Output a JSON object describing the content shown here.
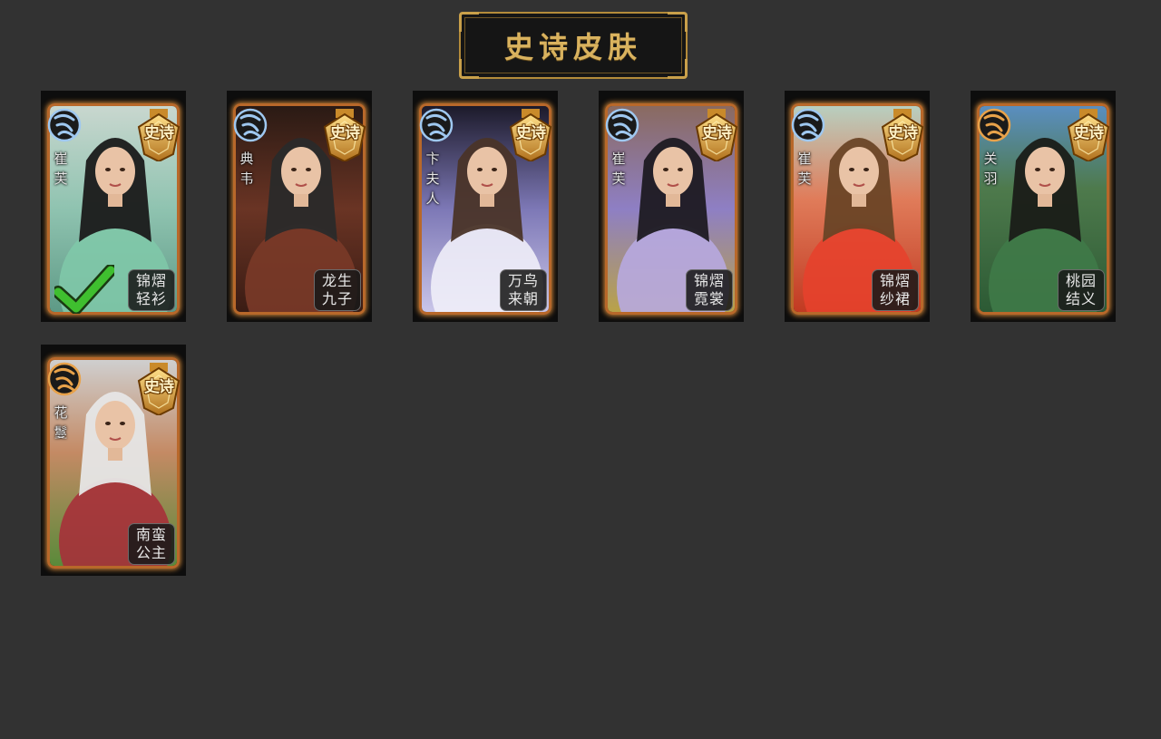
{
  "header": {
    "title": "史诗皮肤"
  },
  "badge_label": "史诗",
  "colors": {
    "background": "#323232",
    "gold": "#d9b25e",
    "card_frame": "#b8682a",
    "wei": "#9fc8f0",
    "shu": "#e8a24a",
    "check": "#3fbf2f"
  },
  "cards": [
    {
      "faction_icon": "wei-faction-icon",
      "hero": "崔芙",
      "skin": "锦熠轻衫",
      "selected": true
    },
    {
      "faction_icon": "wei-faction-icon",
      "hero": "典韦",
      "skin": "龙生九子",
      "selected": false
    },
    {
      "faction_icon": "wei-faction-icon",
      "hero": "卞夫人",
      "skin": "万鸟来朝",
      "selected": false
    },
    {
      "faction_icon": "wei-faction-icon",
      "hero": "崔芙",
      "skin": "锦熠霓裳",
      "selected": false
    },
    {
      "faction_icon": "wei-faction-icon",
      "hero": "崔芙",
      "skin": "锦熠纱裙",
      "selected": false
    },
    {
      "faction_icon": "shu-faction-icon",
      "hero": "关羽",
      "skin": "桃园结义",
      "selected": false
    },
    {
      "faction_icon": "shu-faction-icon",
      "hero": "花鬘",
      "skin": "南蛮公主",
      "selected": false
    }
  ]
}
